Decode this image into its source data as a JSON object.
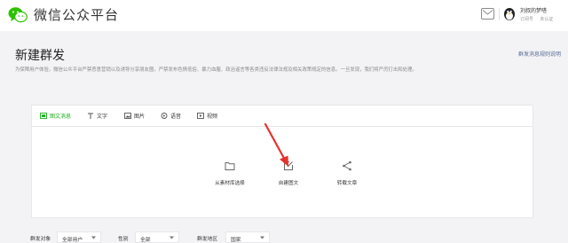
{
  "header": {
    "app_title": "微信公众平台",
    "user": {
      "name": "刘叔的梦嗒",
      "meta": [
        "订阅号",
        "未认证"
      ]
    },
    "icons": {
      "logo": "wechat-logo-icon",
      "mail": "mail-icon",
      "avatar": "penguin-avatar-icon"
    }
  },
  "page": {
    "title": "新建群发",
    "help_link": "群发消息规则说明",
    "notice": "为保障用户体验，微信公众平台严禁恶意营销以及诱导分享朋友圈，严禁发布色情低俗、暴力血腥、政治谣言等各类违反法律法规及相关政策规定的信息。一旦发现，我们将严厉打击和处理。"
  },
  "tabs": [
    {
      "label": "图文消息",
      "icon": "news-icon",
      "active": true
    },
    {
      "label": "文字",
      "icon": "text-icon",
      "active": false
    },
    {
      "label": "图片",
      "icon": "image-icon",
      "active": false
    },
    {
      "label": "语音",
      "icon": "voice-icon",
      "active": false
    },
    {
      "label": "视频",
      "icon": "video-icon",
      "active": false
    }
  ],
  "actions": [
    {
      "label": "从素材库选择",
      "icon": "folder-icon"
    },
    {
      "label": "自建图文",
      "icon": "edit-icon"
    },
    {
      "label": "转载文章",
      "icon": "share-icon"
    }
  ],
  "filters": [
    {
      "label": "群发对象",
      "value": "全部用户"
    },
    {
      "label": "性别",
      "value": "全部"
    },
    {
      "label": "群发地区",
      "value": "国家"
    }
  ],
  "colors": {
    "accent": "#1aad19",
    "link": "#576b95",
    "arrow": "#e5322d"
  }
}
